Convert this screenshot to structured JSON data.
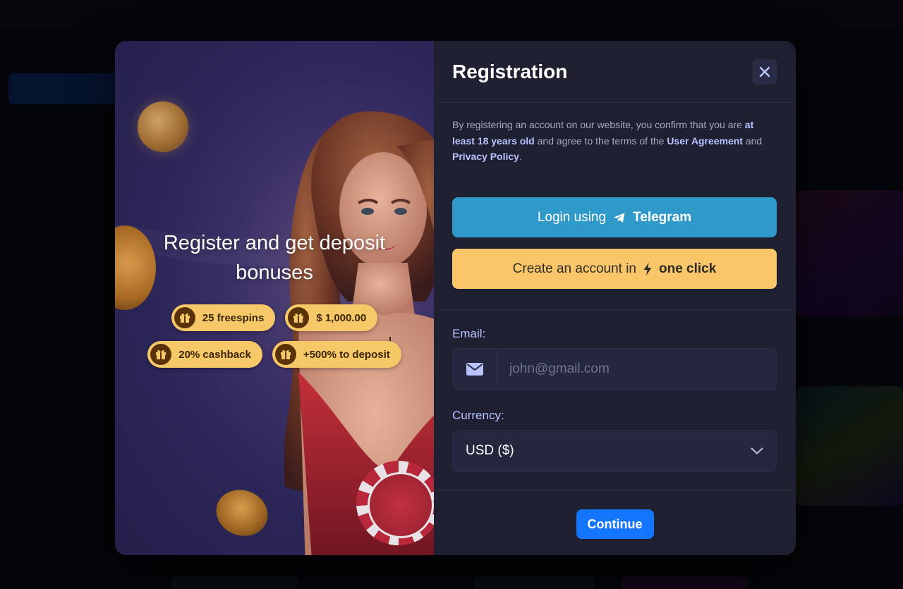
{
  "colors": {
    "accent_blue": "#1476ff",
    "telegram": "#2f9ac9",
    "oneclick": "#f9c76a",
    "badge": "#f6c867",
    "link": "#b9c4ff"
  },
  "promo": {
    "title": "Register and get deposit bonuses",
    "badges_row1": [
      {
        "icon": "gift-icon",
        "label": "25 freespins"
      },
      {
        "icon": "gift-icon",
        "label": "$ 1,000.00"
      }
    ],
    "badges_row2": [
      {
        "icon": "gift-icon",
        "label": "20% cashback"
      },
      {
        "icon": "gift-icon",
        "label": "+500% to deposit"
      }
    ]
  },
  "form": {
    "title": "Registration",
    "close_icon": "close-icon",
    "terms": {
      "text_1": "By registering an account on our website, you confirm that you are ",
      "age": "at least 18 years old",
      "text_2": " and agree to the terms of the ",
      "user_agreement": "User Agreement",
      "text_3": " and ",
      "privacy": "Privacy Policy",
      "text_4": "."
    },
    "telegram_button": {
      "prefix": "Login using",
      "icon": "telegram-icon",
      "label": "Telegram"
    },
    "oneclick_button": {
      "prefix": "Create an account in",
      "icon": "lightning-icon",
      "label": "one click"
    },
    "email": {
      "label": "Email:",
      "icon": "envelope-icon",
      "value": "",
      "placeholder": "john@gmail.com"
    },
    "currency": {
      "label": "Currency:",
      "value": "USD ($)",
      "icon": "chevron-down-icon"
    },
    "continue_label": "Continue"
  }
}
